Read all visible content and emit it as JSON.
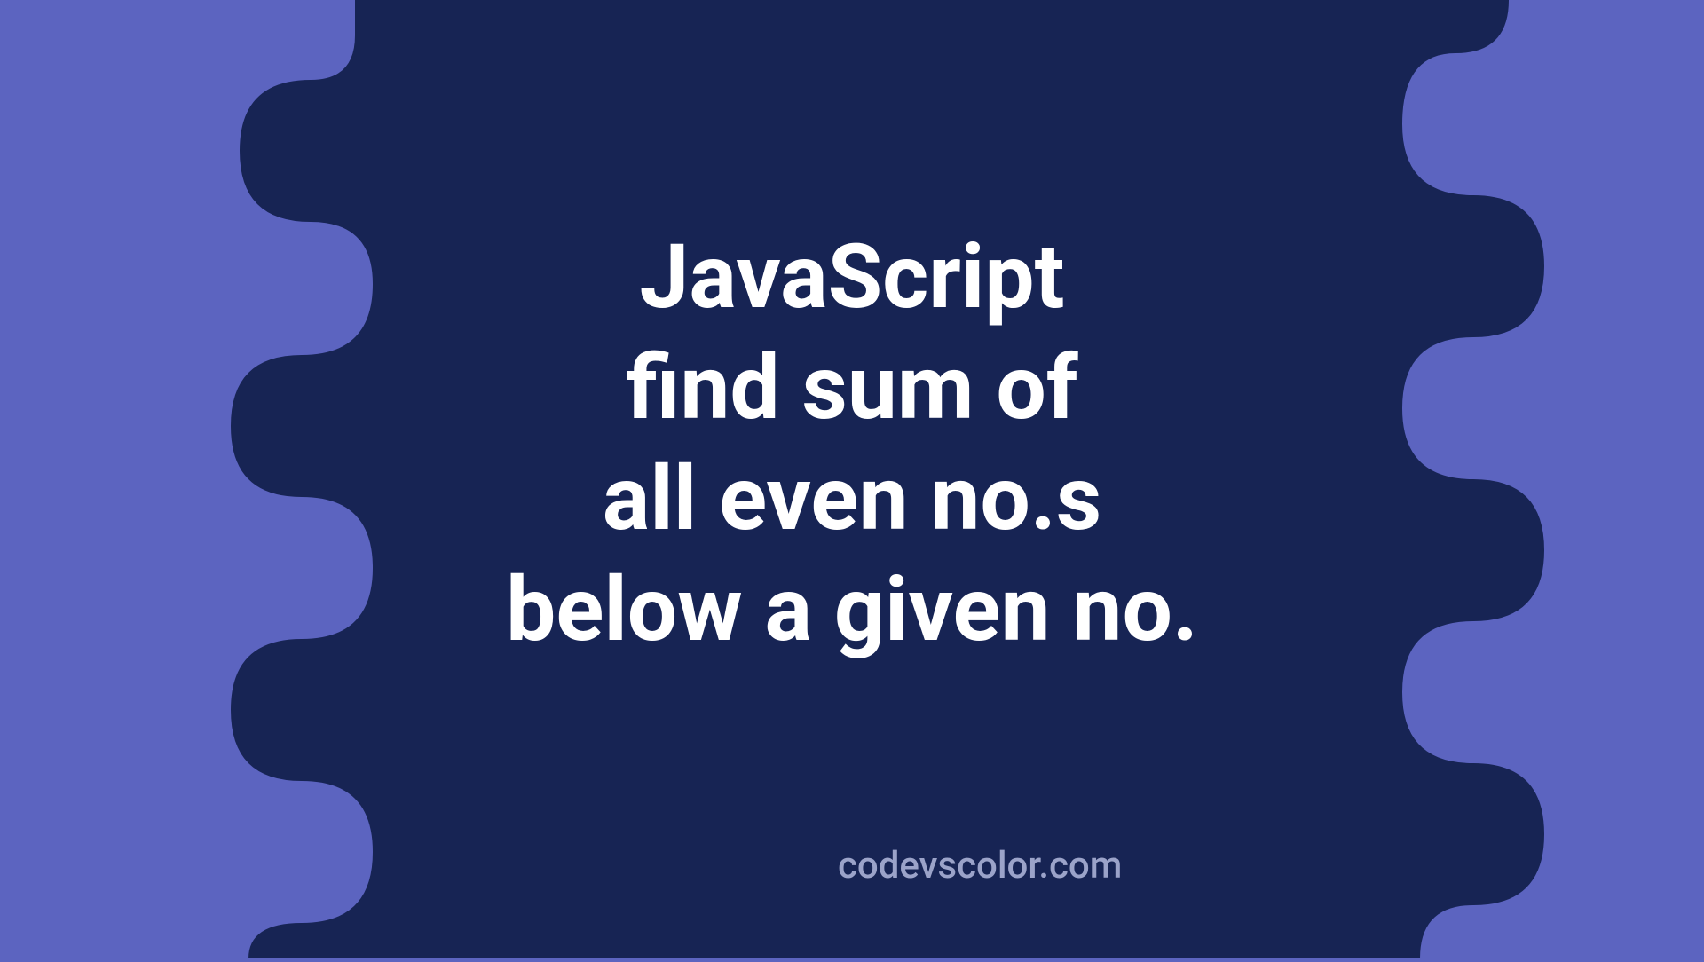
{
  "title_lines": "JavaScript\nfind sum of\nall even no.s\nbelow a given no.",
  "attribution": "codevscolor.com",
  "colors": {
    "background": "#5c64c0",
    "blob": "#172454",
    "text": "#ffffff",
    "attribution": "#9ba3c9"
  }
}
